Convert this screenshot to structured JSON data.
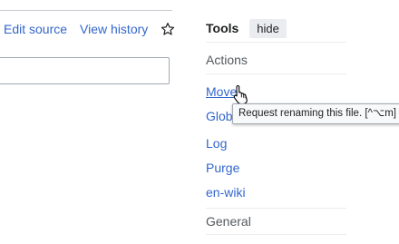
{
  "tabs": {
    "edit_source": "Edit source",
    "view_history": "View history",
    "watch_icon": "star-icon"
  },
  "tools": {
    "title": "Tools",
    "hide_label": "hide",
    "actions_heading": "Actions",
    "links": [
      "Move",
      "Global usage",
      "Log",
      "Purge",
      "en-wiki"
    ],
    "general_heading": "General"
  },
  "tooltip": {
    "text": "Request renaming this file. [^⌥m]"
  },
  "colors": {
    "link": "#3366cc",
    "text": "#202122",
    "muted": "#54595d",
    "button_bg": "#eaecf0",
    "border": "#a2a9b1"
  }
}
